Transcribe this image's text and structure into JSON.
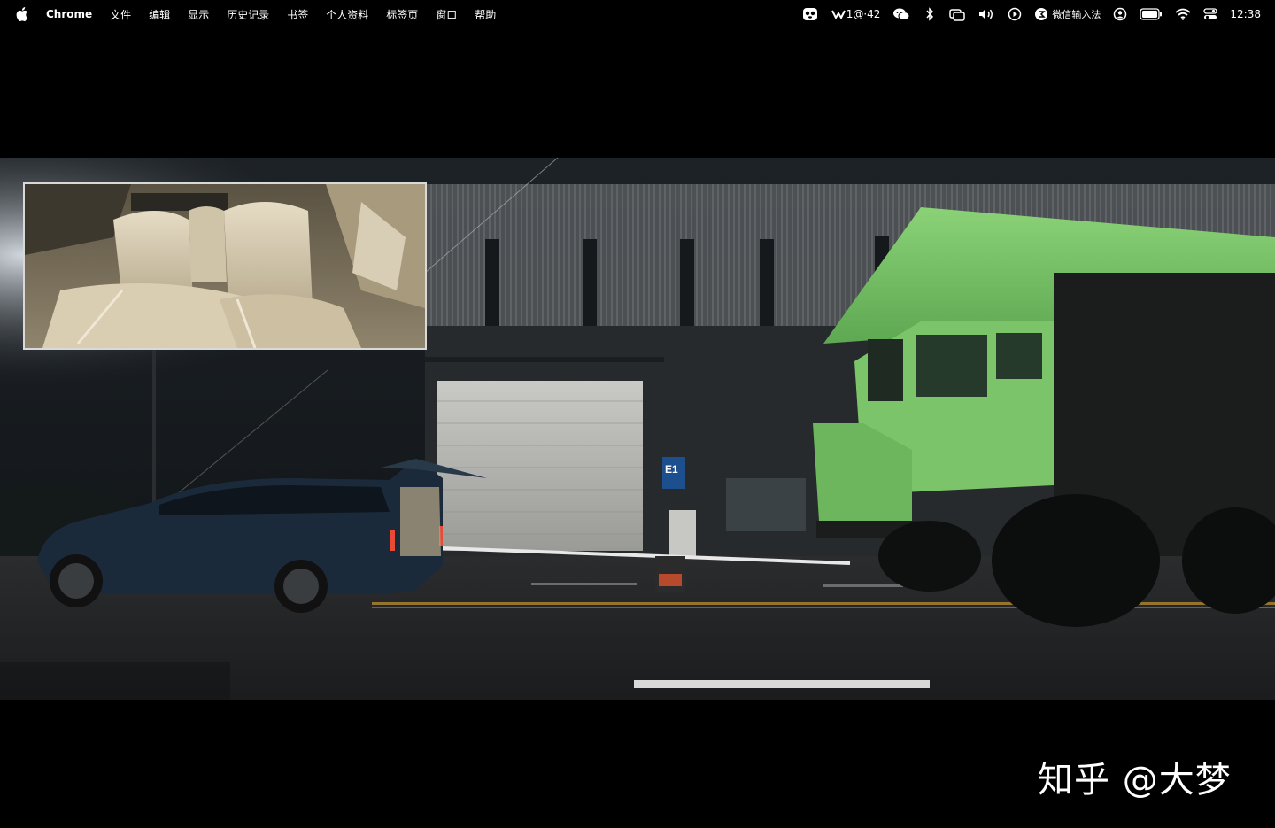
{
  "menubar": {
    "app_name": "Chrome",
    "items": [
      "文件",
      "编辑",
      "显示",
      "历史记录",
      "书签",
      "个人资料",
      "标签页",
      "窗口",
      "帮助"
    ],
    "status": {
      "weather_text": "1@·42",
      "input_method": "微信输入法",
      "clock": "12:38"
    },
    "icons": [
      "panda-icon",
      "weather-icon",
      "wechat-icon",
      "bluetooth-icon",
      "screen-mirror-icon",
      "volume-icon",
      "play-icon",
      "input-method-icon",
      "user-icon",
      "battery-icon",
      "wifi-icon",
      "control-center-icon"
    ]
  },
  "video": {
    "building_sign": "E1",
    "watermark": "知乎 @大梦"
  },
  "colors": {
    "truck_green": "#7cc46a",
    "car_blue": "#1b2a3a",
    "seat_beige": "#d9cdb2"
  }
}
